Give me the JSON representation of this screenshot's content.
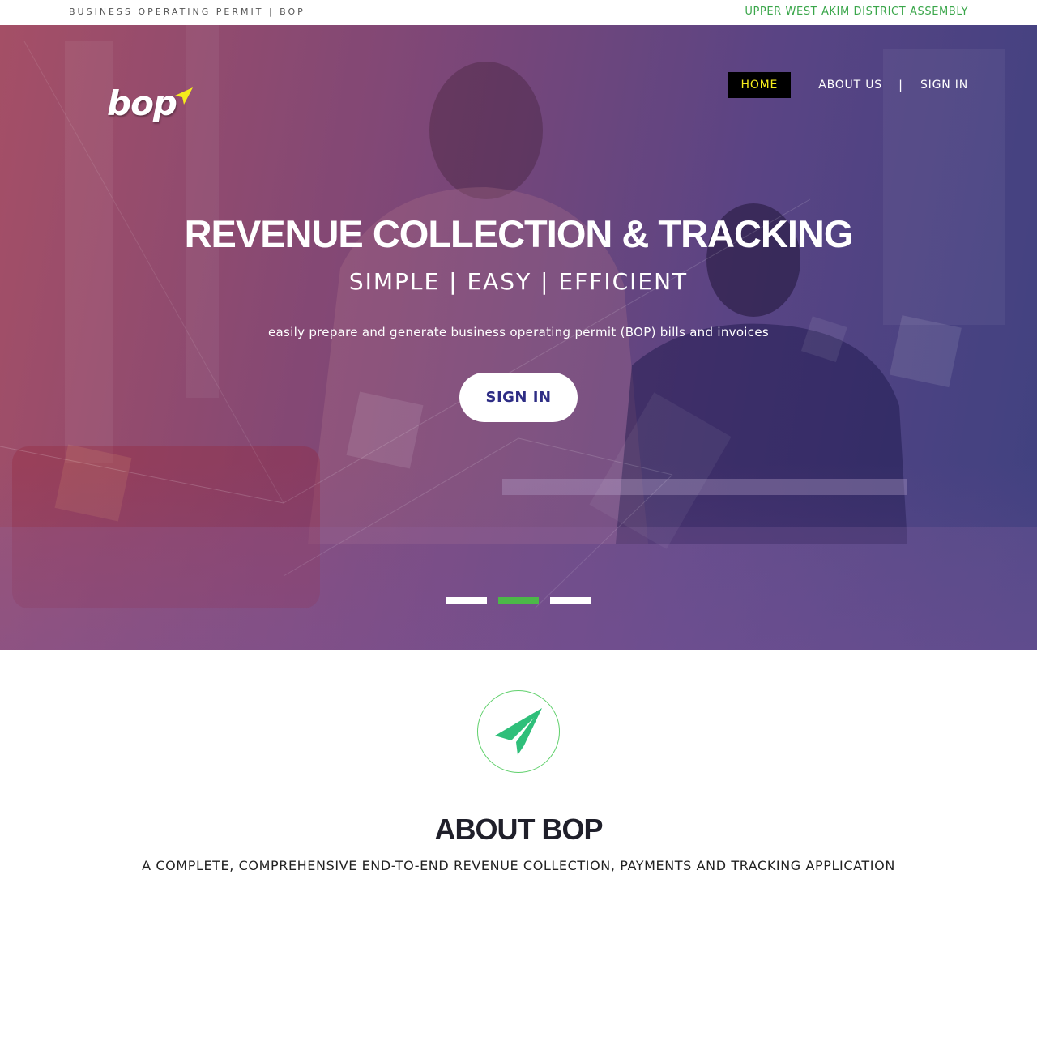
{
  "topbar": {
    "left_text": "BUSINESS OPERATING PERMIT | BOP",
    "right_text": "UPPER WEST AKIM DISTRICT ASSEMBLY"
  },
  "logo": {
    "text": "bop",
    "icon": "arrow-pointer-icon"
  },
  "nav": {
    "home": "HOME",
    "about": "ABOUT US",
    "separator": "|",
    "signin": "SIGN IN"
  },
  "hero": {
    "title": "REVENUE COLLECTION & TRACKING",
    "subtitle": "SIMPLE | EASY | EFFICIENT",
    "description": "easily prepare and generate business operating permit (BOP) bills and invoices",
    "button": "SIGN IN",
    "slides": {
      "count": 3,
      "active_index": 1
    }
  },
  "about": {
    "icon": "paper-plane-icon",
    "title": "ABOUT BOP",
    "subtitle": "A COMPLETE, COMPREHENSIVE END-TO-END REVENUE COLLECTION, PAYMENTS AND TRACKING APPLICATION"
  },
  "colors": {
    "accent_green": "#4cb848",
    "nav_active_text": "#f5ec1c",
    "button_text": "#2e2d85",
    "district_text": "#3aa64a",
    "icon_green": "#2fbf7a"
  }
}
